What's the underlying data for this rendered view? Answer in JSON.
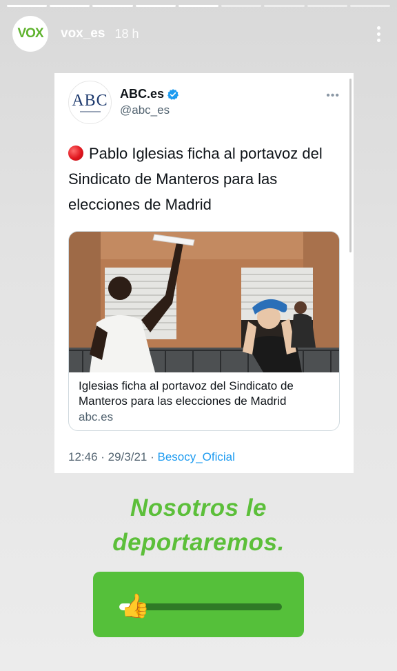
{
  "story": {
    "progress": {
      "segments": 9,
      "completed": 5
    },
    "header": {
      "avatar_text": "VOX",
      "username": "vox_es",
      "time": "18 h",
      "more_icon": "vertical-dots-icon"
    }
  },
  "tweet": {
    "avatar_text": "ABC",
    "account_name": "ABC.es",
    "verified_icon": "verified-badge-icon",
    "handle": "@abc_es",
    "more_icon": "horizontal-dots-icon",
    "text_emoji": "red-circle-icon",
    "text": "Pablo Iglesias ficha al portavoz del Sindicato de Manteros para las elecciones de Madrid",
    "link_card": {
      "image_description": "photo",
      "title": "Iglesias ficha al portavoz del Sindicato de Manteros para las elecciones de Madrid",
      "domain": "abc.es"
    },
    "timestamp": "12:46 · 29/3/21 · ",
    "source": "Besocy_Oficial"
  },
  "caption": {
    "line1": "Nosotros le",
    "line2": "deportaremos."
  },
  "slider_sticker": {
    "emoji": "👍",
    "value_percent": 5,
    "colors": {
      "background": "#55c03a",
      "track": "#2f7a26",
      "fill": "#ffffff"
    }
  },
  "colors": {
    "vox_green": "#5fb32e",
    "caption_green": "#5cbf3a",
    "twitter_blue": "#1d9bf0"
  }
}
